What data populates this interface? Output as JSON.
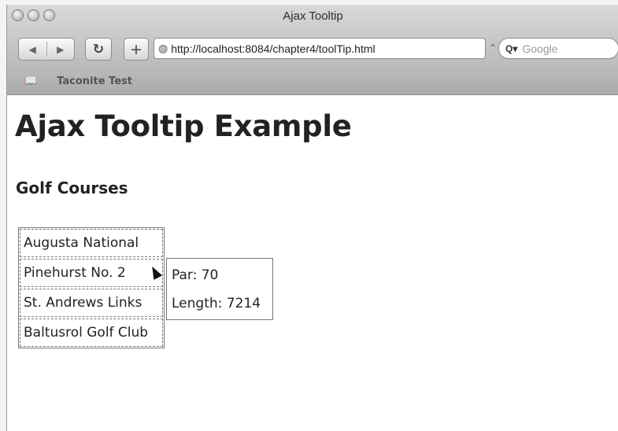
{
  "window": {
    "title": "Ajax Tooltip"
  },
  "toolbar": {
    "back_icon": "back-arrow-icon",
    "forward_icon": "forward-arrow-icon",
    "reload_icon": "reload-icon",
    "add_icon": "add-bookmark-icon",
    "url": "http://localhost:8084/chapter4/toolTip.html",
    "search_placeholder": "Google"
  },
  "bookmarks_bar": {
    "items": [
      "Taconite Test"
    ]
  },
  "page": {
    "heading": "Ajax Tooltip Example",
    "subheading": "Golf Courses",
    "courses": [
      "Augusta National",
      "Pinehurst No. 2",
      "St. Andrews Links",
      "Baltusrol Golf Club"
    ],
    "tooltip": {
      "par_line": "Par: 70",
      "length_line": "Length: 7214"
    }
  }
}
